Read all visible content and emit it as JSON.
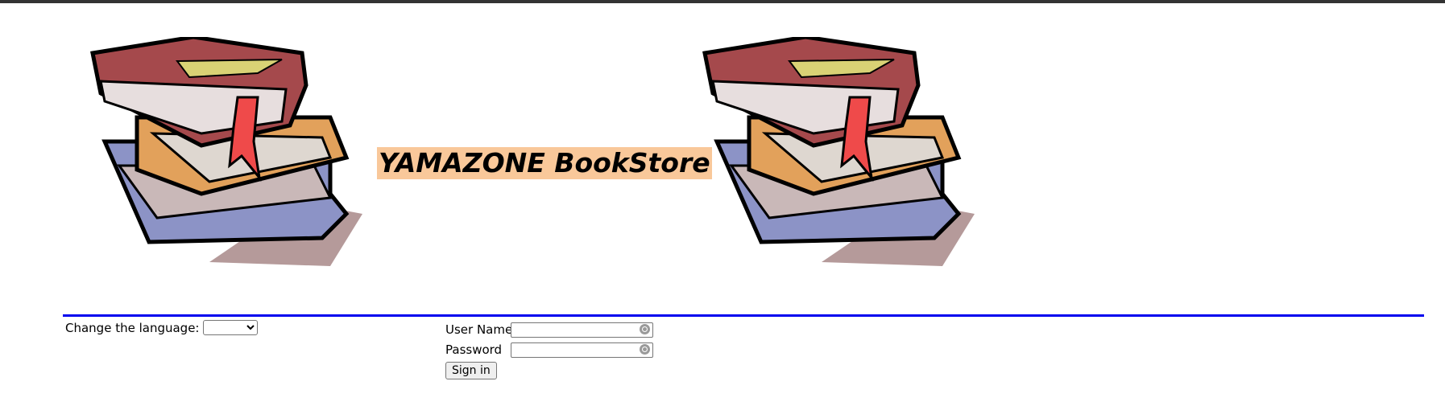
{
  "header": {
    "title": "YAMAZONE BookStore"
  },
  "language": {
    "label": "Change the language:",
    "selected": ""
  },
  "login": {
    "username_label": "User Name",
    "username_value": "",
    "password_label": "Password",
    "password_value": "",
    "signin_label": "Sign in"
  },
  "icons": {
    "left": "book-stack-icon",
    "right": "book-stack-icon",
    "field": "password-key-icon"
  },
  "colors": {
    "divider": "#0000ee",
    "title_bg": "#f9c89a",
    "top_bar": "#333333"
  }
}
